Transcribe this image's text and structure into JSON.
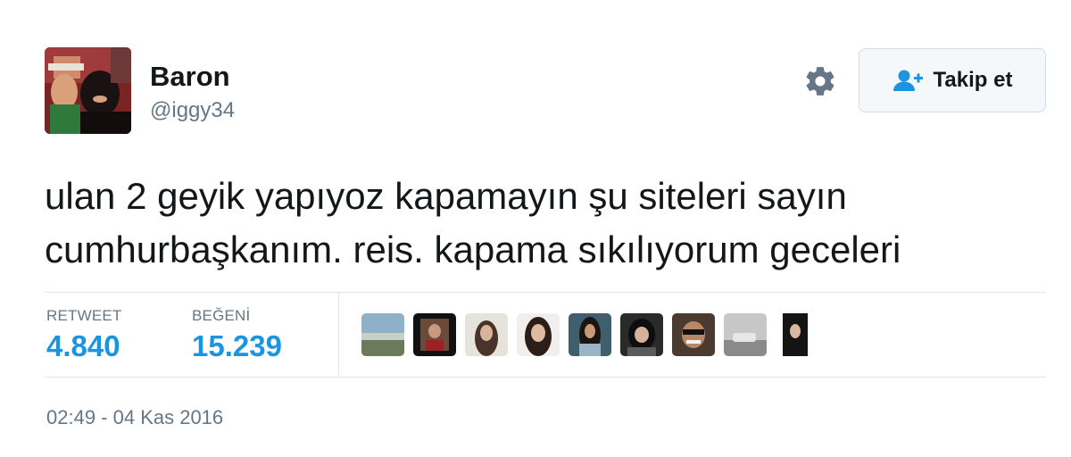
{
  "user": {
    "display_name": "Baron",
    "handle": "@iggy34"
  },
  "actions": {
    "follow_label": "Takip et"
  },
  "tweet": {
    "text": "ulan 2 geyik yapıyoz kapamayın şu siteleri sayın\ncumhurbaşkanım. reis. kapama sıkılıyorum geceleri"
  },
  "stats": {
    "retweets_label": "RETWEET",
    "retweets_value": "4.840",
    "likes_label": "BEĞENİ",
    "likes_value": "15.239"
  },
  "timestamp": "02:49 - 04 Kas 2016",
  "colors": {
    "accent": "#1b95e0",
    "muted": "#657786",
    "text": "#14171a",
    "border": "#e1e8ed"
  },
  "icons": {
    "settings": "gear-icon",
    "follow": "person-add-icon"
  }
}
